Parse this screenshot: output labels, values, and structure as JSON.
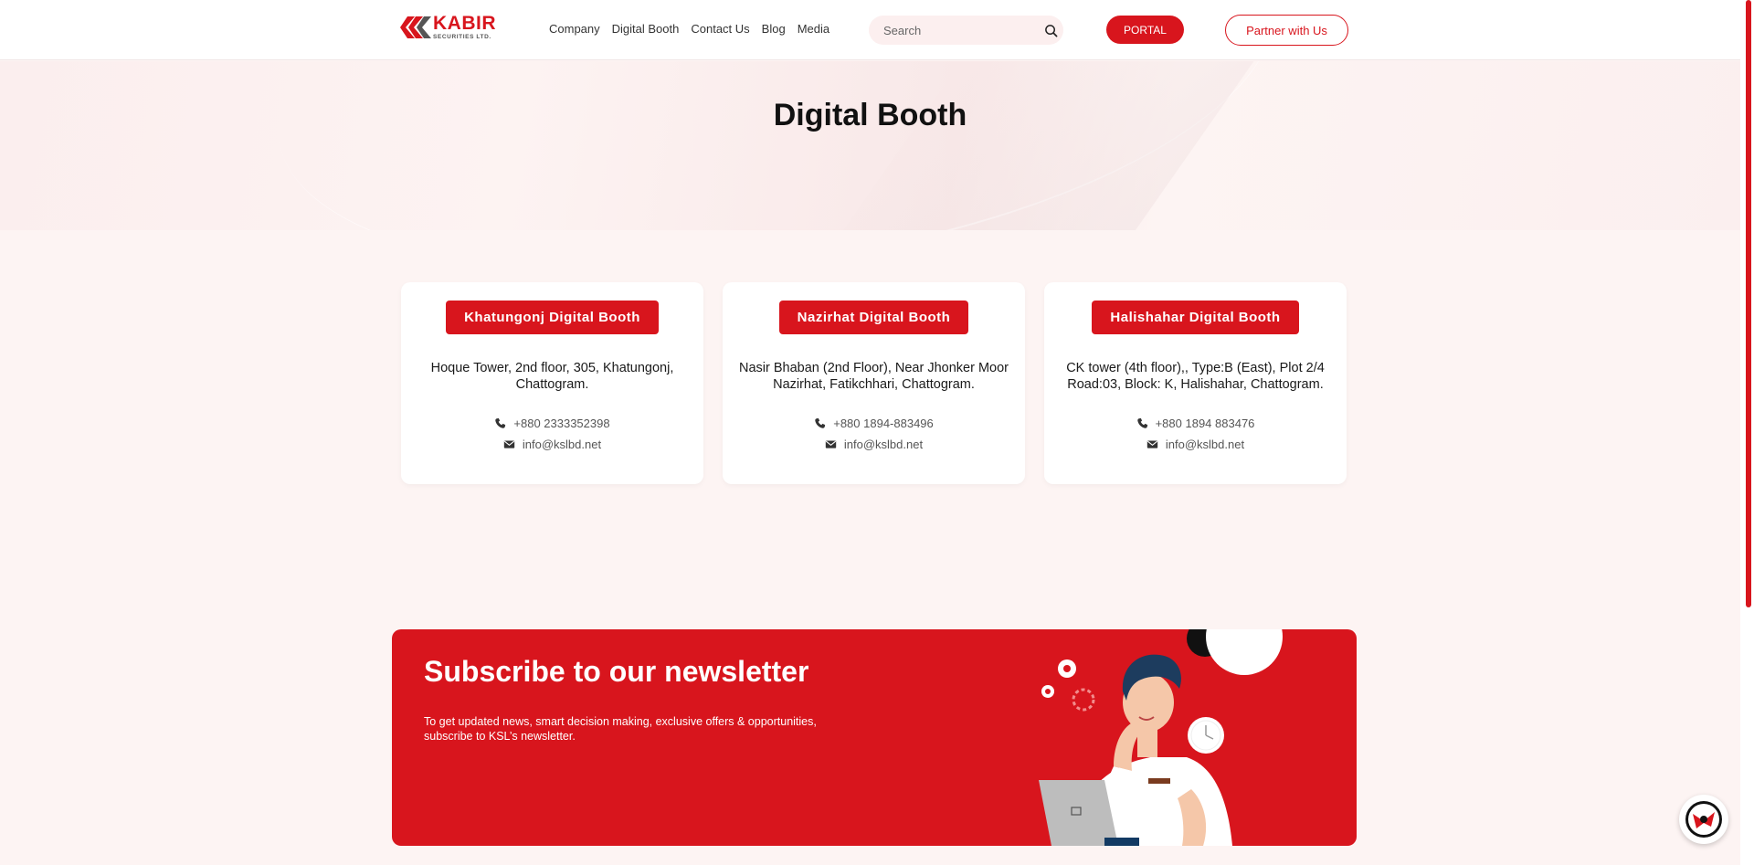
{
  "header": {
    "logo": {
      "name": "KABIR",
      "subtitle": "SECURITIES LTD."
    },
    "nav": [
      "Company",
      "Digital Booth",
      "Contact Us",
      "Blog",
      "Media"
    ],
    "search": {
      "placeholder": "Search",
      "value": ""
    },
    "portal_label": "PORTAL",
    "partner_label": "Partner with Us"
  },
  "hero": {
    "title": "Digital Booth"
  },
  "booths": [
    {
      "title": "Khatungonj Digital Booth",
      "address": "Hoque Tower, 2nd floor, 305, Khatungonj, Chattogram.",
      "phone": "+880 2333352398",
      "email": "info@kslbd.net"
    },
    {
      "title": "Nazirhat Digital Booth",
      "address": "Nasir Bhaban (2nd Floor), Near Jhonker Moor Nazirhat, Fatikchhari, Chattogram.",
      "phone": "+880 1894-883496",
      "email": "info@kslbd.net"
    },
    {
      "title": "Halishahar Digital Booth",
      "address": "CK tower (4th floor),, Type:B (East), Plot 2/4 Road:03, Block: K, Halishahar, Chattogram.",
      "phone": "+880 1894 883476",
      "email": "info@kslbd.net"
    }
  ],
  "newsletter": {
    "title": "Subscribe to our newsletter",
    "description": "To get updated news, smart decision making, exclusive offers & opportunities, subscribe to KSL’s newsletter."
  },
  "colors": {
    "brand": "#d8151d",
    "background": "#fdf4f3"
  },
  "icons": [
    "search-icon",
    "phone-icon",
    "envelope-icon",
    "chat-icon"
  ]
}
